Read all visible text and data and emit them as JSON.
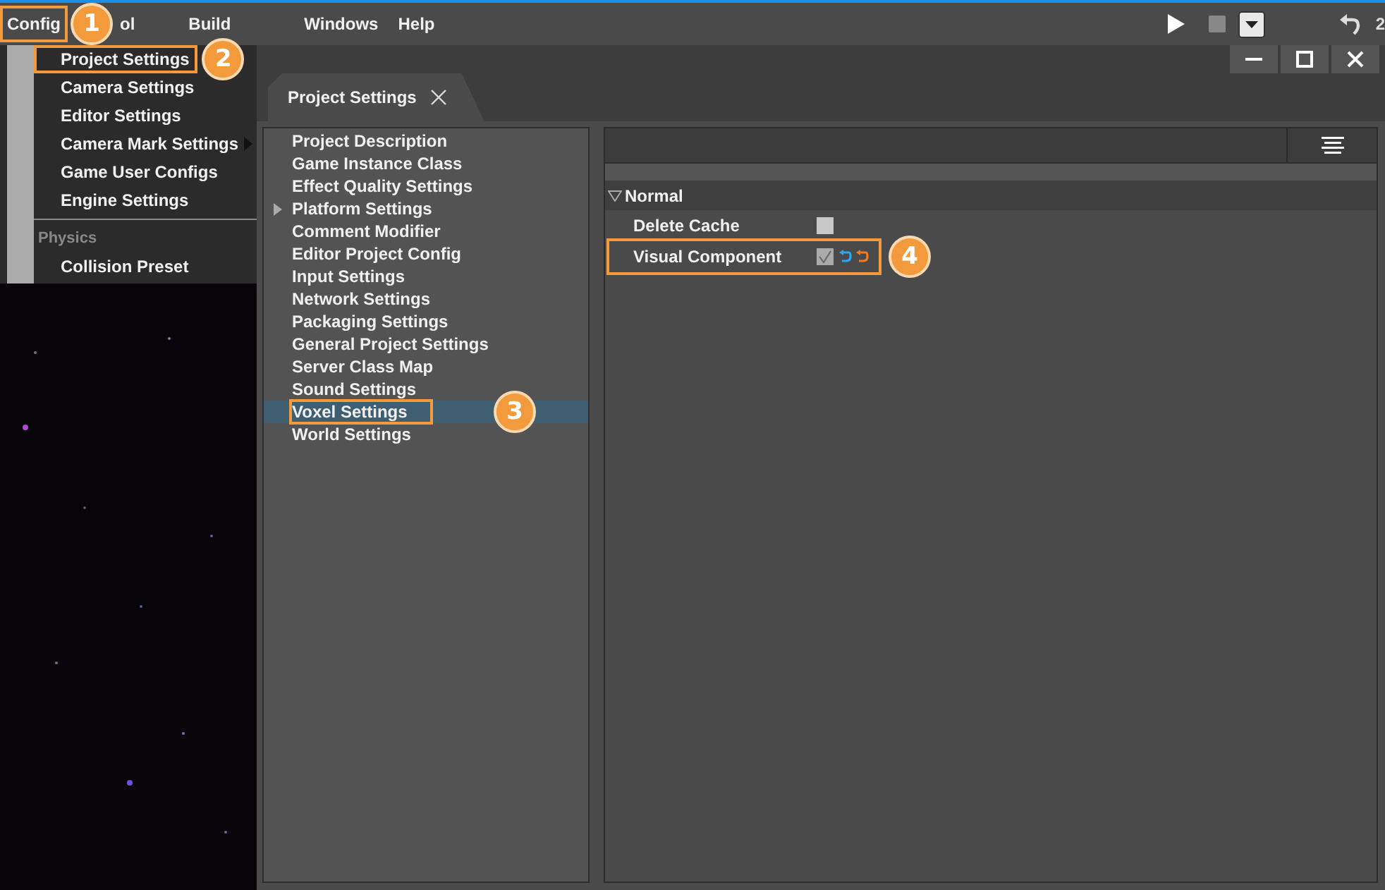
{
  "menu_bar": {
    "items": [
      {
        "label": "Config",
        "highlighted": true,
        "callout": "1"
      },
      {
        "label": "ol",
        "highlighted": false
      },
      {
        "label": "Build",
        "highlighted": false
      },
      {
        "label": "Windows",
        "highlighted": false
      },
      {
        "label": "Help",
        "highlighted": false
      }
    ],
    "counter": "2"
  },
  "config_menu": {
    "items": [
      {
        "kind": "item",
        "label": "Project Settings",
        "highlighted": true,
        "submenu": false,
        "callout": "2"
      },
      {
        "kind": "item",
        "label": "Camera Settings",
        "highlighted": false,
        "submenu": false
      },
      {
        "kind": "item",
        "label": "Editor Settings",
        "highlighted": false,
        "submenu": false
      },
      {
        "kind": "item",
        "label": "Camera Mark Settings",
        "highlighted": false,
        "submenu": true
      },
      {
        "kind": "item",
        "label": "Game User Configs",
        "highlighted": false,
        "submenu": false
      },
      {
        "kind": "item",
        "label": "Engine Settings",
        "highlighted": false,
        "submenu": false
      },
      {
        "kind": "separator"
      },
      {
        "kind": "header",
        "label": "Physics"
      },
      {
        "kind": "item",
        "label": "Collision Preset",
        "highlighted": false,
        "submenu": false
      }
    ]
  },
  "settings_tab": {
    "title": "Project Settings"
  },
  "categories": [
    {
      "label": "Project Description",
      "selected": false,
      "expandable": false
    },
    {
      "label": "Game Instance Class",
      "selected": false,
      "expandable": false
    },
    {
      "label": "Effect Quality Settings",
      "selected": false,
      "expandable": false
    },
    {
      "label": "Platform Settings",
      "selected": false,
      "expandable": true
    },
    {
      "label": "Comment Modifier",
      "selected": false,
      "expandable": false
    },
    {
      "label": "Editor Project Config",
      "selected": false,
      "expandable": false
    },
    {
      "label": "Input Settings",
      "selected": false,
      "expandable": false
    },
    {
      "label": "Network Settings",
      "selected": false,
      "expandable": false
    },
    {
      "label": "Packaging Settings",
      "selected": false,
      "expandable": false
    },
    {
      "label": "General Project Settings",
      "selected": false,
      "expandable": false
    },
    {
      "label": "Server Class Map",
      "selected": false,
      "expandable": false
    },
    {
      "label": "Sound Settings",
      "selected": false,
      "expandable": false
    },
    {
      "label": "Voxel Settings",
      "selected": true,
      "expandable": false,
      "callout": "3"
    },
    {
      "label": "World Settings",
      "selected": false,
      "expandable": false
    }
  ],
  "details": {
    "section": {
      "title": "Normal",
      "expanded": true
    },
    "properties": [
      {
        "label": "Delete Cache",
        "checked": false,
        "modified": false,
        "highlighted": false
      },
      {
        "label": "Visual Component",
        "checked": true,
        "modified": true,
        "highlighted": true,
        "callout": "4"
      }
    ]
  }
}
